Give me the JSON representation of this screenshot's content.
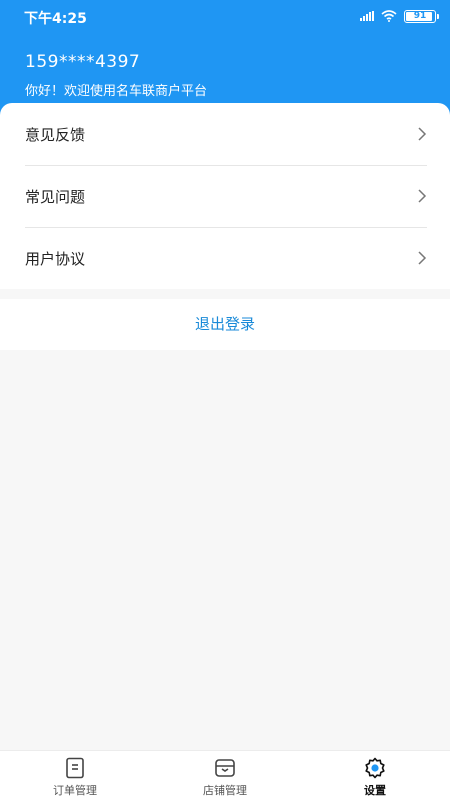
{
  "status_bar": {
    "time": "下午4:25",
    "battery": "91"
  },
  "header": {
    "phone": "159****4397",
    "greeting": "你好！欢迎使用名车联商户平台"
  },
  "menu": {
    "items": [
      {
        "label": "意见反馈"
      },
      {
        "label": "常见问题"
      },
      {
        "label": "用户协议"
      }
    ]
  },
  "logout": {
    "label": "退出登录"
  },
  "tabs": [
    {
      "label": "订单管理",
      "icon": "order-icon"
    },
    {
      "label": "店铺管理",
      "icon": "store-icon"
    },
    {
      "label": "设置",
      "icon": "settings-icon",
      "active": true
    }
  ],
  "colors": {
    "primary": "#1f96f3",
    "link": "#1a8ad8",
    "background": "#f7f7f7"
  }
}
